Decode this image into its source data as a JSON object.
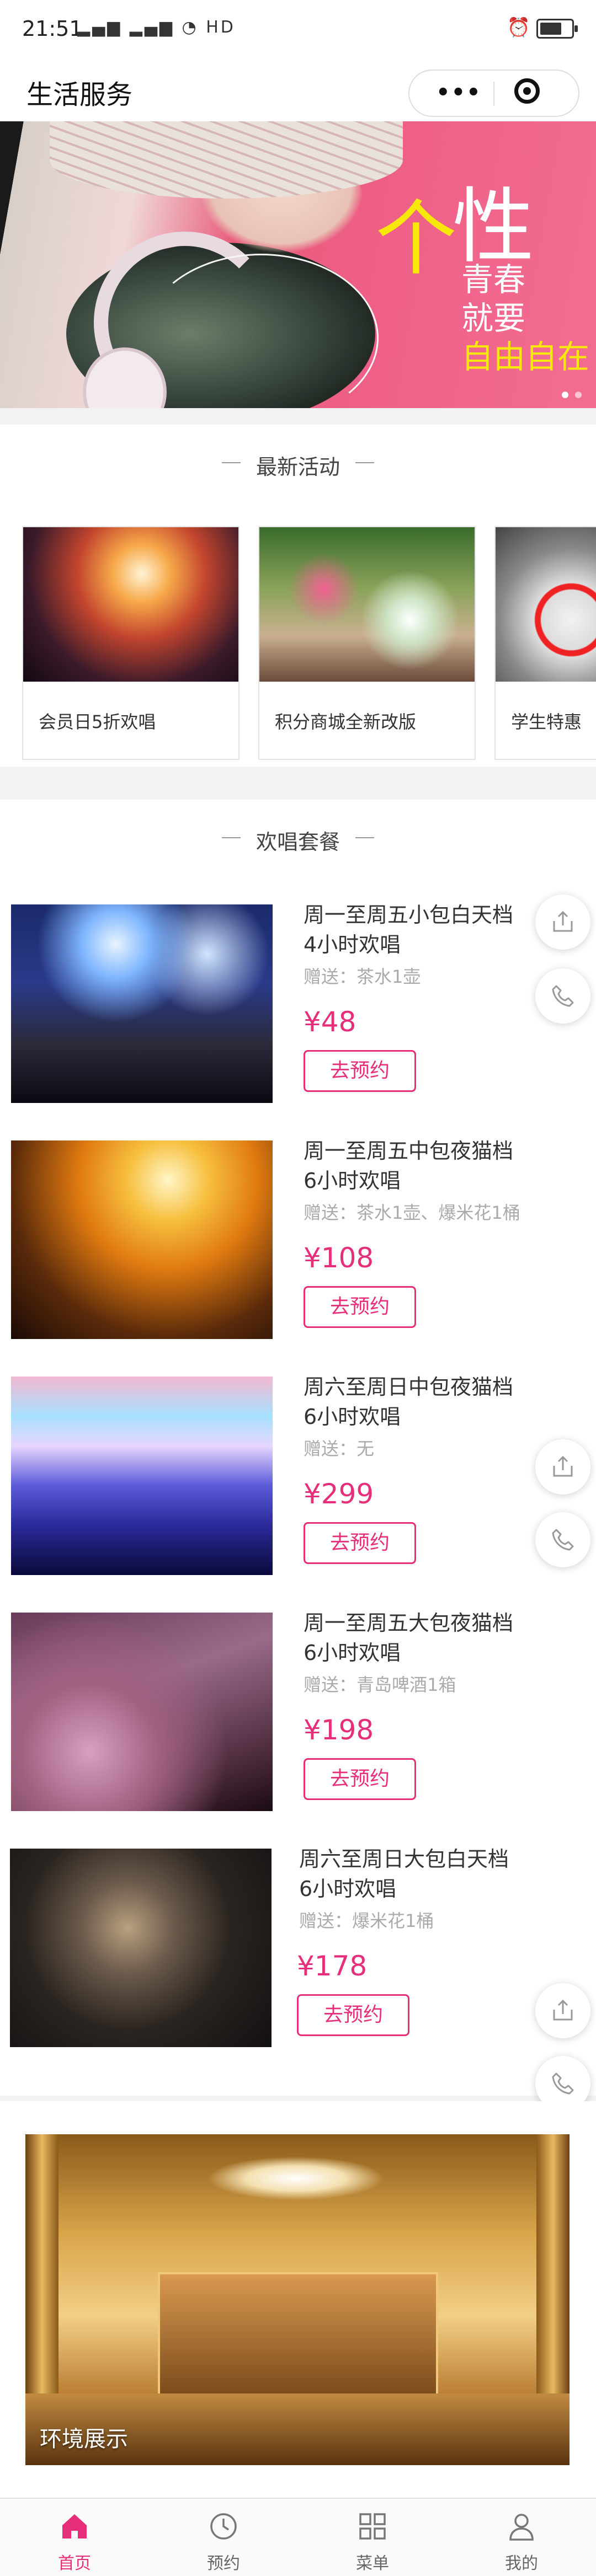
{
  "status": {
    "time": "21:51",
    "signal": "▂▄▆ ▂▄▆ ◔ HD"
  },
  "nav": {
    "title": "生活服务",
    "menu_label": "•••"
  },
  "banner": {
    "big1": "个",
    "big2": "性",
    "line1": "青春",
    "line2": "就要",
    "line3": "自由自在"
  },
  "activities": {
    "title": "最新活动",
    "items": [
      {
        "label": "会员日5折欢唱"
      },
      {
        "label": "积分商城全新改版"
      },
      {
        "label": "学生特惠"
      }
    ]
  },
  "packages": {
    "title": "欢唱套餐",
    "items": [
      {
        "line1": "周一至周五小包白天档",
        "line2": "4小时欢唱",
        "gift": "赠送：茶水1壶",
        "price": "¥48",
        "button": "去预约"
      },
      {
        "line1": "周一至周五中包夜猫档",
        "line2": "6小时欢唱",
        "gift": "赠送：茶水1壶、爆米花1桶",
        "price": "¥108",
        "button": "去预约"
      },
      {
        "line1": "周六至周日中包夜猫档",
        "line2": "6小时欢唱",
        "gift": "赠送：无",
        "price": "¥299",
        "button": "去预约"
      },
      {
        "line1": "周一至周五大包夜猫档",
        "line2": " 6小时欢唱",
        "gift": "赠送：青岛啤酒1箱",
        "price": "¥198",
        "button": "去预约"
      },
      {
        "line1": "周六至周日大包白天档",
        "line2": "6小时欢唱",
        "gift": "赠送：爆米花1桶",
        "price": "¥178",
        "button": "去预约"
      }
    ]
  },
  "environment": {
    "label": "环境展示"
  },
  "tabbar": {
    "items": [
      {
        "label": "首页",
        "icon": "home-icon"
      },
      {
        "label": "预约",
        "icon": "clock-icon"
      },
      {
        "label": "菜单",
        "icon": "grid-icon"
      },
      {
        "label": "我的",
        "icon": "user-icon"
      }
    ]
  },
  "colors": {
    "accent": "#e62e7b",
    "background": "#f2f2f2"
  }
}
